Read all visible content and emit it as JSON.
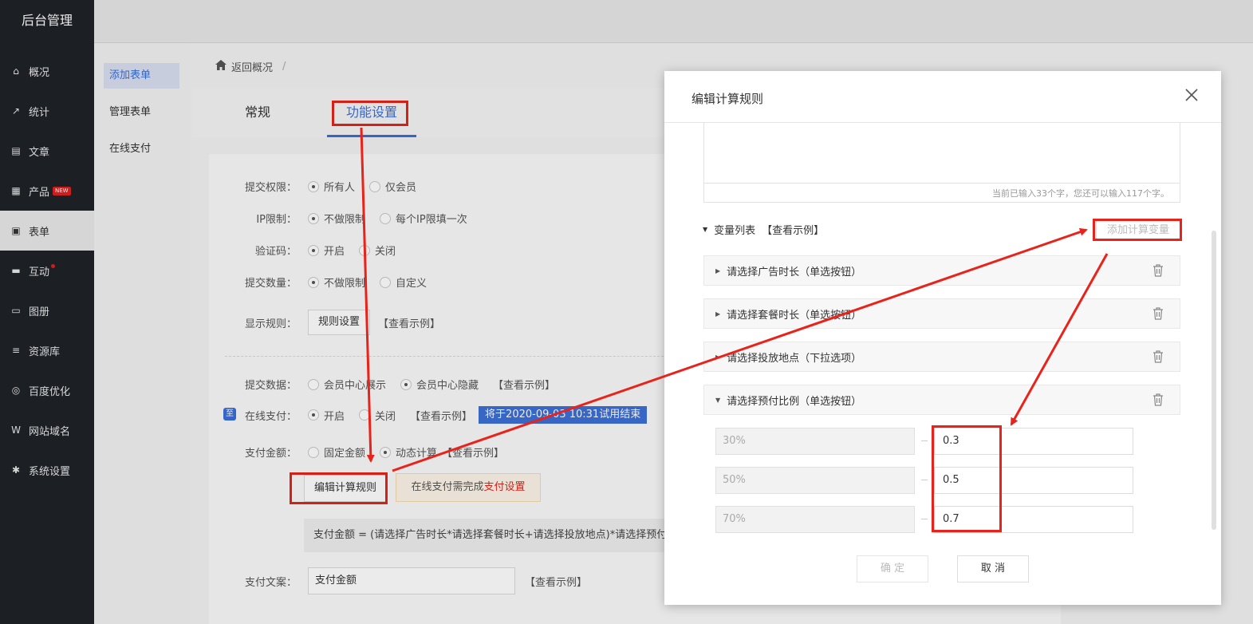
{
  "app_title": "后台管理",
  "nav": [
    {
      "label": "概况",
      "icon": "home-icon"
    },
    {
      "label": "统计",
      "icon": "chart-icon"
    },
    {
      "label": "文章",
      "icon": "document-icon"
    },
    {
      "label": "产品",
      "icon": "grid-icon",
      "badge": "NEW"
    },
    {
      "label": "表单",
      "icon": "calendar-icon",
      "active": true
    },
    {
      "label": "互动",
      "icon": "chat-icon",
      "dot": true
    },
    {
      "label": "图册",
      "icon": "image-icon"
    },
    {
      "label": "资源库",
      "icon": "database-icon"
    },
    {
      "label": "百度优化",
      "icon": "target-icon"
    },
    {
      "label": "网站域名",
      "icon": "w-icon"
    },
    {
      "label": "系统设置",
      "icon": "gear-icon"
    }
  ],
  "subnav": [
    "添加表单",
    "管理表单",
    "在线支付"
  ],
  "breadcrumb": {
    "back": "返回概况",
    "sep": "/"
  },
  "tabs": [
    "常规",
    "功能设置"
  ],
  "form": {
    "submit_permission": {
      "label": "提交权限：",
      "options": [
        "所有人",
        "仅会员"
      ]
    },
    "ip_limit": {
      "label": "IP限制：",
      "options": [
        "不做限制",
        "每个IP限填一次"
      ]
    },
    "captcha": {
      "label": "验证码：",
      "options": [
        "开启",
        "关闭"
      ]
    },
    "submit_count": {
      "label": "提交数量：",
      "options": [
        "不做限制",
        "自定义"
      ]
    },
    "display_rule": {
      "label": "显示规则：",
      "button": "规则设置",
      "example": "【查看示例】"
    },
    "submit_data": {
      "label": "提交数据：",
      "options": [
        "会员中心展示",
        "会员中心隐藏"
      ],
      "example": "【查看示例】"
    },
    "online_pay": {
      "label": "在线支付：",
      "options": [
        "开启",
        "关闭"
      ],
      "example": "【查看示例】",
      "trial": "将于2020-09-03 10:31试用结束",
      "badge": "至"
    },
    "pay_amount": {
      "label": "支付金额：",
      "options": [
        "固定金额",
        "动态计算"
      ],
      "example": "【查看示例】"
    },
    "edit_rule_button": "编辑计算规则",
    "notice_prefix": "在线支付需完成",
    "notice_link": "支付设置",
    "formula": "支付金额 = (请选择广告时长*请选择套餐时长+请选择投放地点)*请选择预付比例",
    "pay_text": {
      "label": "支付文案：",
      "value": "支付金额",
      "example": "【查看示例】"
    }
  },
  "modal": {
    "title": "编辑计算规则",
    "counter": "当前已输入33个字，您还可以输入117个字。",
    "var_list_label": "变量列表",
    "var_example": "【查看示例】",
    "add_var": "添加计算变量",
    "variables": [
      "请选择广告时长（单选按钮）",
      "请选择套餐时长（单选按钮）",
      "请选择投放地点（下拉选项）",
      "请选择预付比例（单选按钮）"
    ],
    "options": [
      {
        "label": "30%",
        "value": "0.3"
      },
      {
        "label": "50%",
        "value": "0.5"
      },
      {
        "label": "70%",
        "value": "0.7"
      }
    ],
    "confirm": "确 定",
    "cancel": "取 消"
  }
}
